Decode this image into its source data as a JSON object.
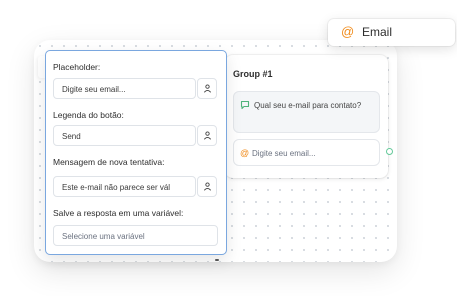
{
  "group": {
    "title": "Group #1",
    "bubble_text": "Qual seu e-mail para contato?",
    "input_icon": "@",
    "input_text": "Digite seu email..."
  },
  "settings": {
    "placeholder_label": "Placeholder:",
    "placeholder_value": "Digite seu email...",
    "button_label_label": "Legenda do botão:",
    "button_label_value": "Send",
    "retry_label": "Mensagem de nova tentativa:",
    "retry_value": "Este e-mail não parece ser vál",
    "save_label": "Salve a resposta em uma variável:",
    "save_placeholder": "Selecione uma variável"
  },
  "email_chip": {
    "icon": "@",
    "label": "Email"
  },
  "colors": {
    "accent_orange": "#f18c1c",
    "bubble_green": "#4fb37a",
    "panel_border": "#7aa7df"
  },
  "icons": [
    "at-icon",
    "chat-bubble-icon",
    "user-variable-icon"
  ]
}
